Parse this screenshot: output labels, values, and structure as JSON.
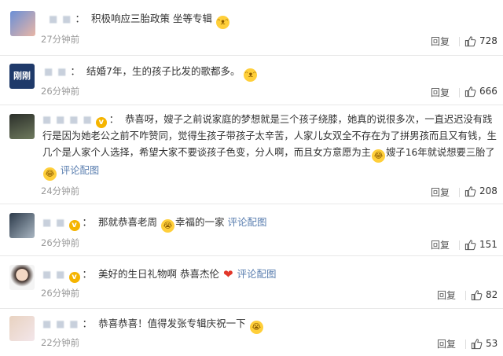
{
  "comments": [
    {
      "username": "■ ■",
      "text": "积极响应三胎政策 坐等专辑",
      "time": "27分钟前",
      "reply": "回复",
      "likes": "728"
    },
    {
      "username": "■ ■",
      "text": "结婚7年，生的孩子比发的歌都多。",
      "time": "26分钟前",
      "reply": "回复",
      "likes": "666",
      "avatar_text": "刚刚"
    },
    {
      "username": "■ ■ ■ ■",
      "line1": "恭喜呀，嫂子之前说家庭的梦想就是三个孩子绕膝，她真的说很多次，一直迟迟没有践",
      "line2": "行是因为她老公之前不咋赞同，觉得生孩子带孩子太辛苦，人家儿女双全不存在为了拼男孩而且又有钱，生",
      "line3": "几个是人家个人选择，希望大家不要谈孩子色变，分人啊，而且女方意愿为主",
      "line3b": "嫂子16年就说想要三胎了",
      "link": "评论配图",
      "time": "24分钟前",
      "reply": "回复",
      "likes": "208"
    },
    {
      "username": "■ ■",
      "text": "那就恭喜老周",
      "text2": "幸福的一家",
      "link": "评论配图",
      "time": "26分钟前",
      "reply": "回复",
      "likes": "151"
    },
    {
      "username": "■ ■",
      "text": "美好的生日礼物啊 恭喜杰伦",
      "link": "评论配图",
      "time": "26分钟前",
      "reply": "回复",
      "likes": "82"
    },
    {
      "username": "■ ■ ■",
      "text": "恭喜恭喜！值得发张专辑庆祝一下",
      "time": "22分钟前",
      "reply": "回复",
      "likes": "53"
    }
  ],
  "colors": {
    "link": "#5b7fb0",
    "vip": "#f5b400",
    "muted": "#999999"
  }
}
